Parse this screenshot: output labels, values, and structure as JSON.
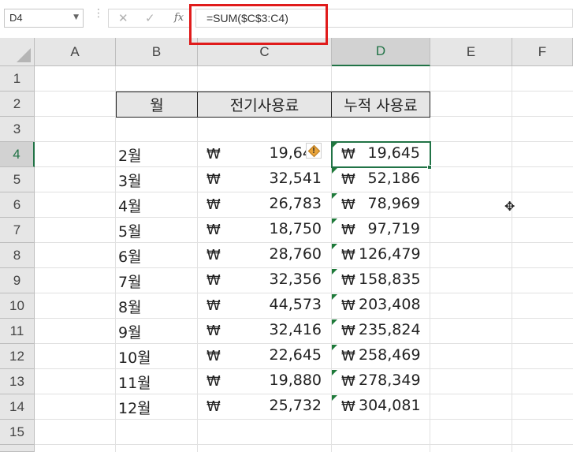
{
  "formula_bar": {
    "name_box": "D4",
    "formula": "=SUM($C$3:C4)"
  },
  "columns": [
    "A",
    "B",
    "C",
    "D",
    "E",
    "F"
  ],
  "rows": [
    "1",
    "2",
    "3",
    "4",
    "5",
    "6",
    "7",
    "8",
    "9",
    "10",
    "11",
    "12",
    "13",
    "14",
    "15"
  ],
  "selected": {
    "column": "D",
    "row": "4"
  },
  "table": {
    "headers": [
      "월",
      "전기사용료",
      "누적 사용료"
    ],
    "currency_symbol": "₩",
    "data_rows": [
      {
        "month": "2월",
        "usage": "19,645",
        "cumulative": "19,645"
      },
      {
        "month": "3월",
        "usage": "32,541",
        "cumulative": "52,186"
      },
      {
        "month": "4월",
        "usage": "26,783",
        "cumulative": "78,969"
      },
      {
        "month": "5월",
        "usage": "18,750",
        "cumulative": "97,719"
      },
      {
        "month": "6월",
        "usage": "28,760",
        "cumulative": "126,479"
      },
      {
        "month": "7월",
        "usage": "32,356",
        "cumulative": "158,835"
      },
      {
        "month": "8월",
        "usage": "44,573",
        "cumulative": "203,408"
      },
      {
        "month": "9월",
        "usage": "32,416",
        "cumulative": "235,824"
      },
      {
        "month": "10월",
        "usage": "22,645",
        "cumulative": "258,469"
      },
      {
        "month": "11월",
        "usage": "19,880",
        "cumulative": "278,349"
      },
      {
        "month": "12월",
        "usage": "25,732",
        "cumulative": "304,081"
      }
    ]
  },
  "icons": {
    "cancel": "close-icon",
    "enter": "check-icon",
    "function": "fx-icon",
    "error_indicator": "warning-icon"
  },
  "colors": {
    "selection": "#217346",
    "highlight_box": "#e01b1b",
    "error_triangle": "#1f7a3a"
  }
}
